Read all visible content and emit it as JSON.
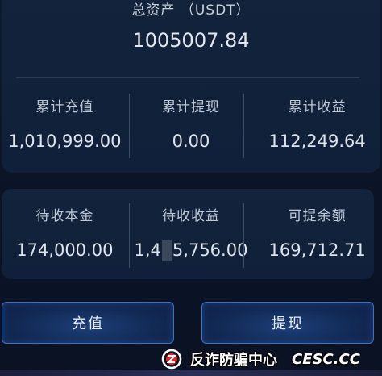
{
  "summary": {
    "total_label": "总资产 （USDT）",
    "total_value": "1005007.84",
    "stats": [
      {
        "label": "累计充值",
        "value": "1,010,999.00"
      },
      {
        "label": "累计提现",
        "value": "0.00"
      },
      {
        "label": "累计收益",
        "value": "112,249.64"
      }
    ]
  },
  "pending": {
    "stats": [
      {
        "label": "待收本金",
        "value": "174,000.00"
      },
      {
        "label": "待收收益",
        "value_prefix": "1,4",
        "value_suffix": "5,756.00"
      },
      {
        "label": "可提余额",
        "value": "169,712.71"
      }
    ]
  },
  "actions": {
    "recharge_label": "充值",
    "withdraw_label": "提现"
  },
  "watermark": {
    "text": "反诈防骗中心",
    "site": "CESC.CC"
  },
  "colors": {
    "accent": "#3a72c8",
    "card": "#13233b",
    "background": "#0c1528"
  }
}
